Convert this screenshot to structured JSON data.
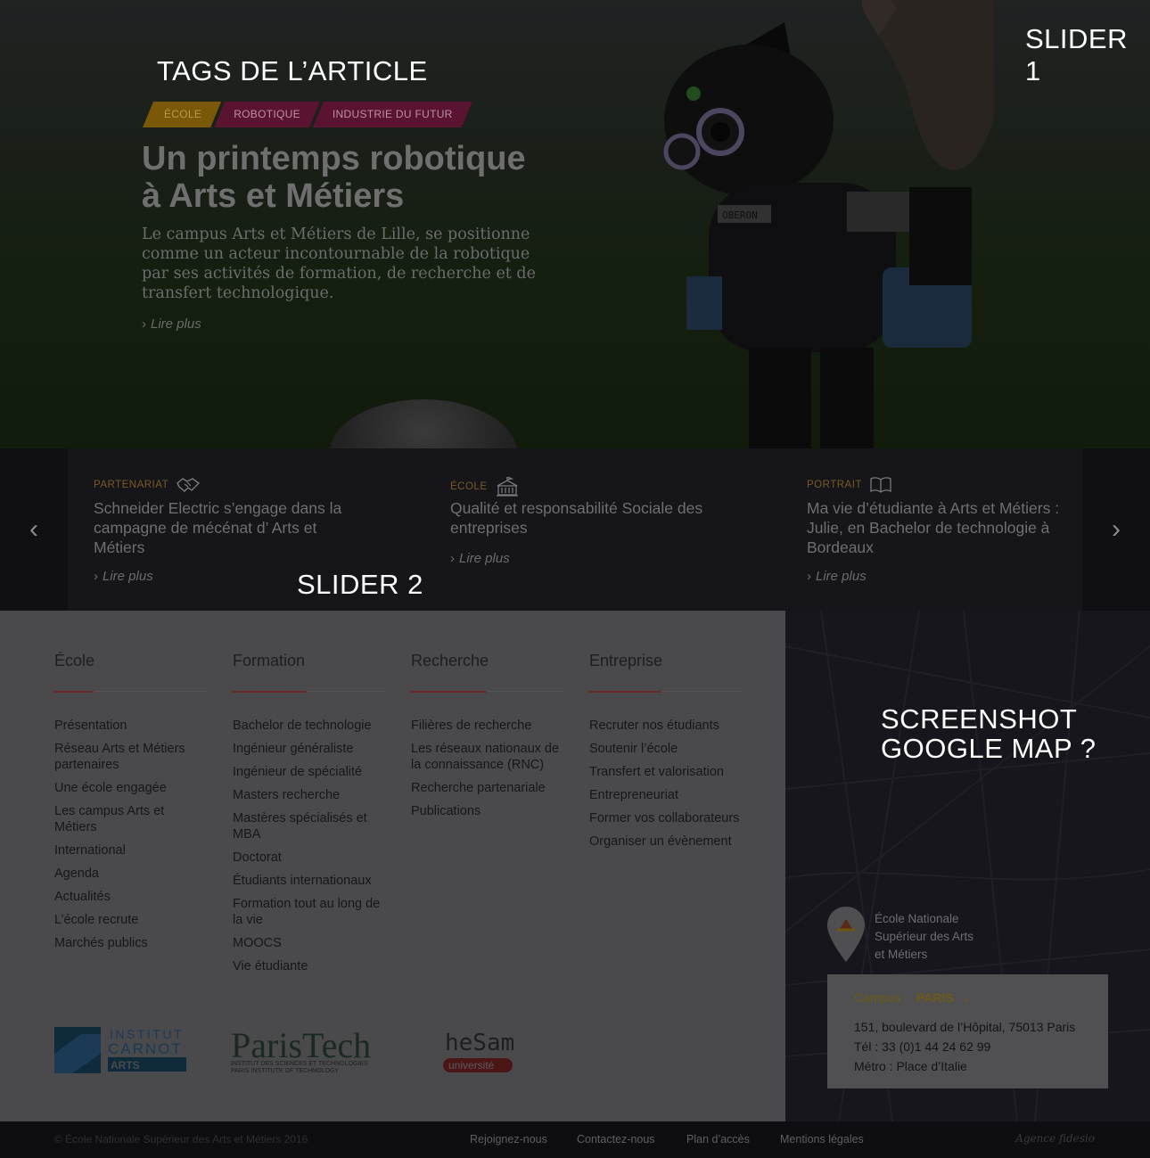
{
  "annotations": {
    "tags_note": "TAGS DE L’ARTICLE",
    "slider1_note": "SLIDER 1",
    "slider2_note": "SLIDER 2",
    "map_note_line1": "SCREENSHOT",
    "map_note_line2": "GOOGLE MAP ?"
  },
  "hero": {
    "tags": [
      "ÉCOLE",
      "ROBOTIQUE",
      "INDUSTRIE DU FUTUR"
    ],
    "title_line1": "Un printemps robotique",
    "title_line2": "à Arts et Métiers",
    "text": "Le campus Arts et Métiers de Lille, se positionne comme un acteur incontournable de la robotique par ses activités de formation, de recherche et de transfert technologique.",
    "read_more": "Lire plus",
    "robot_badge": "OBERON"
  },
  "slider2": {
    "items": [
      {
        "category": "PARTENARIAT",
        "icon": "handshake-icon",
        "title": "Schneider Electric s’engage dans la campagne de mécénat d’ Arts et Métiers",
        "read_more": "Lire plus"
      },
      {
        "category": "ÉCOLE",
        "icon": "building-icon",
        "title": "Qualité et responsabilité Sociale des entreprises",
        "read_more": "Lire plus"
      },
      {
        "category": "PORTRAIT",
        "icon": "book-icon",
        "title": "Ma vie d’étudiante à Arts et Métiers : Julie, en Bachelor de technologie à Bordeaux",
        "read_more": "Lire plus"
      }
    ]
  },
  "footer": {
    "columns": [
      {
        "title": "École",
        "links": [
          "Présentation",
          "Réseau Arts et Métiers partenaires",
          "Une école engagée",
          "Les campus Arts et Métiers",
          "International",
          "Agenda",
          "Actualités",
          "L’école recrute",
          "Marchés publics"
        ]
      },
      {
        "title": "Formation",
        "links": [
          "Bachelor de technologie",
          "Ingénieur généraliste",
          "Ingénieur de spécialité",
          "Masters recherche",
          "Mastères spécialisés et MBA",
          "Doctorat",
          "Étudiants internationaux",
          "Formation tout au long de la vie",
          "MOOCS",
          "Vie étudiante"
        ]
      },
      {
        "title": "Recherche",
        "links": [
          "Filières de recherche",
          "Les réseaux nationaux de la connaissance (RNC)",
          "Recherche partenariale",
          "Publications"
        ]
      },
      {
        "title": "Entreprise",
        "links": [
          "Recruter nos étudiants",
          "Soutenir l’école",
          "Transfert et valorisation",
          "Entrepreneuriat",
          "Former vos collaborateurs",
          "Organiser un évènement"
        ]
      }
    ],
    "logos": {
      "carnot": {
        "line1": "INSTITUT",
        "line2": "CARNOT",
        "line3": "ARTS"
      },
      "paristech": {
        "name": "ParisTech",
        "sub1": "INSTITUT DES SCIENCES ET TECHNOLOGIES",
        "sub2": "PARIS INSTITUTE OF TECHNOLOGY"
      },
      "hesam": {
        "name": "heSam",
        "sub": "université"
      }
    }
  },
  "map": {
    "pin_label": "École Nationale Supérieur des Arts et Métiers",
    "campus_label": "Campus :",
    "campus_value": "PARIS",
    "address": "151, boulevard de l’Hôpital, 75013 Paris",
    "phone": "Tél : 33 (0)1 44 24 62 99",
    "metro": "Métro : Place d’Italie"
  },
  "bottom": {
    "copyright": "© École Nationale Supérieur des Arts et Métiers 2016",
    "links": [
      "Rejoignez-nous",
      "Contactez-nous",
      "Plan d’accès",
      "Mentions légales"
    ],
    "agency": "Agence fidesio"
  },
  "colors": {
    "tag_ecole": "#7a5808",
    "tag_other": "#5b1332",
    "accent_rule": "#6b2a2a",
    "campus_accent": "#6e5a14"
  }
}
